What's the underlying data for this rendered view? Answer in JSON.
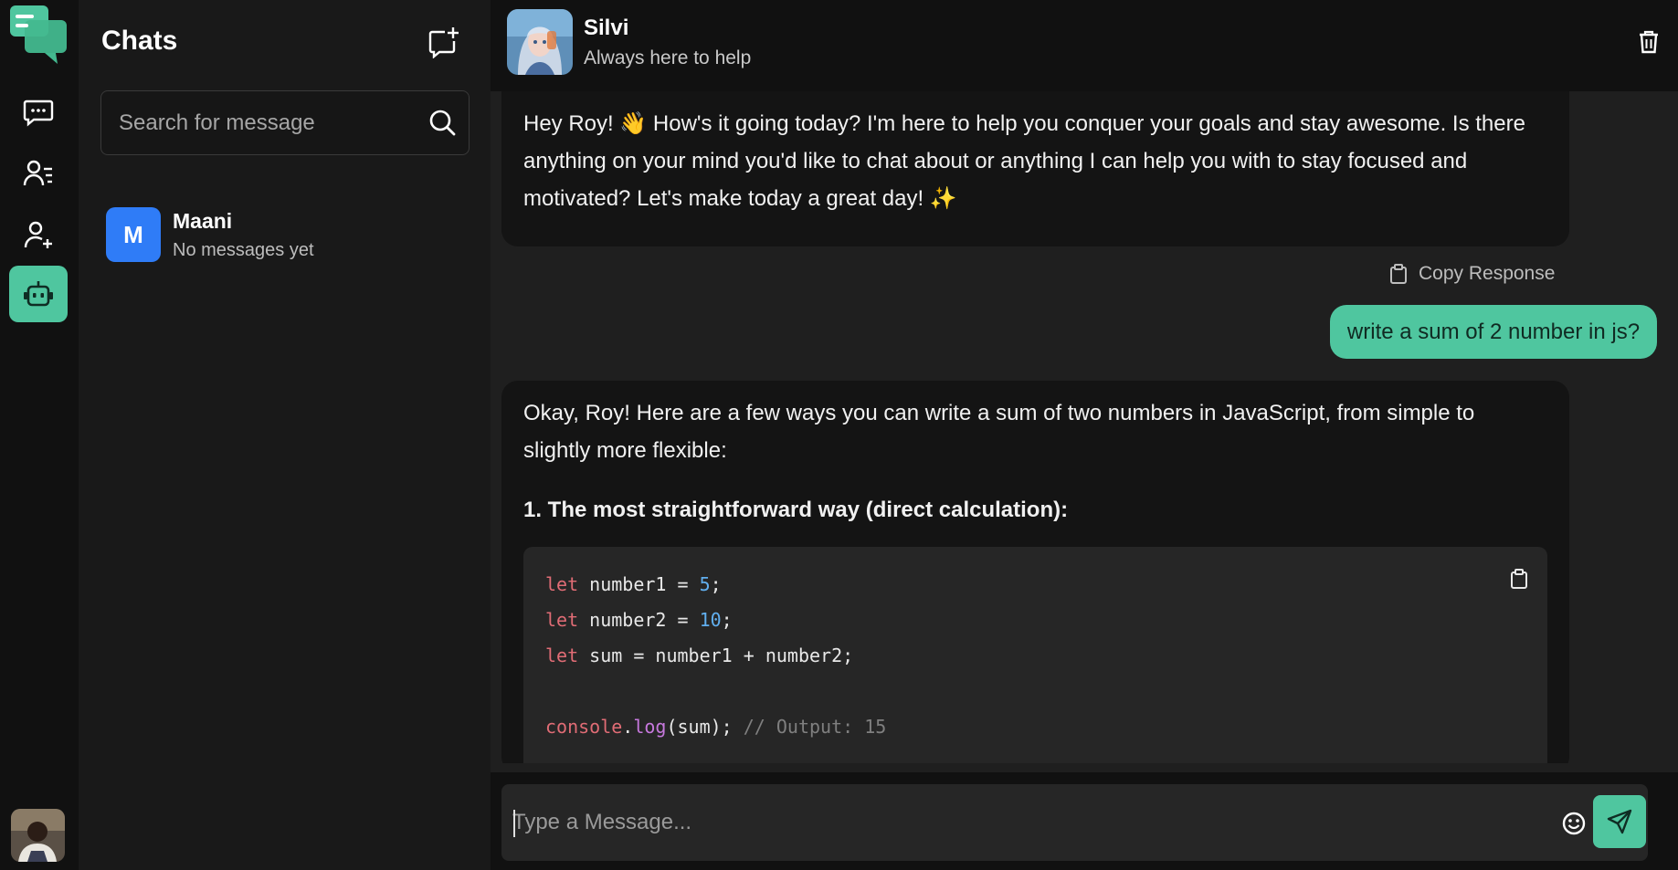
{
  "rail": {
    "items": [
      {
        "name": "chats",
        "icon": "message-dots-icon"
      },
      {
        "name": "contacts",
        "icon": "contacts-list-icon"
      },
      {
        "name": "add-contact",
        "icon": "user-plus-icon"
      },
      {
        "name": "ai-bot",
        "icon": "robot-icon",
        "active": true
      }
    ],
    "accent": "#4fc69f"
  },
  "panel": {
    "title": "Chats",
    "search_placeholder": "Search for message",
    "contacts": [
      {
        "initial": "M",
        "name": "Maani",
        "preview": "No messages yet",
        "avatar_color": "#2f7cf7"
      }
    ]
  },
  "chat": {
    "bot_name": "Silvi",
    "bot_status": "Always here to help",
    "messages": {
      "bot_greeting": "Hey Roy! 👋 How's it going today? I'm here to help you conquer your goals and stay awesome. Is there anything on your mind you'd like to chat about or anything I can help you with to stay focused and motivated? Let's make today a great day! ✨",
      "copy_response": "Copy Response",
      "user_message": "write a sum of 2 number in js?",
      "bot_reply_intro": "Okay, Roy! Here are a few ways you can write a sum of two numbers in JavaScript, from simple to slightly more flexible:",
      "bot_reply_heading": "1. The most straightforward way (direct calculation):",
      "code": {
        "line1_kw": "let",
        "line1_rest": " number1 = ",
        "line1_num": "5",
        "line1_end": ";",
        "line2_kw": "let",
        "line2_rest": " number2 = ",
        "line2_num": "10",
        "line2_end": ";",
        "line3_kw": "let",
        "line3_rest": " sum = number1 + number2;",
        "line5_obj": "console",
        "line5_dot": ".",
        "line5_fn": "log",
        "line5_rest": "(sum); ",
        "line5_comment": "// Output: 15"
      }
    },
    "composer_placeholder": "Type a Message..."
  }
}
